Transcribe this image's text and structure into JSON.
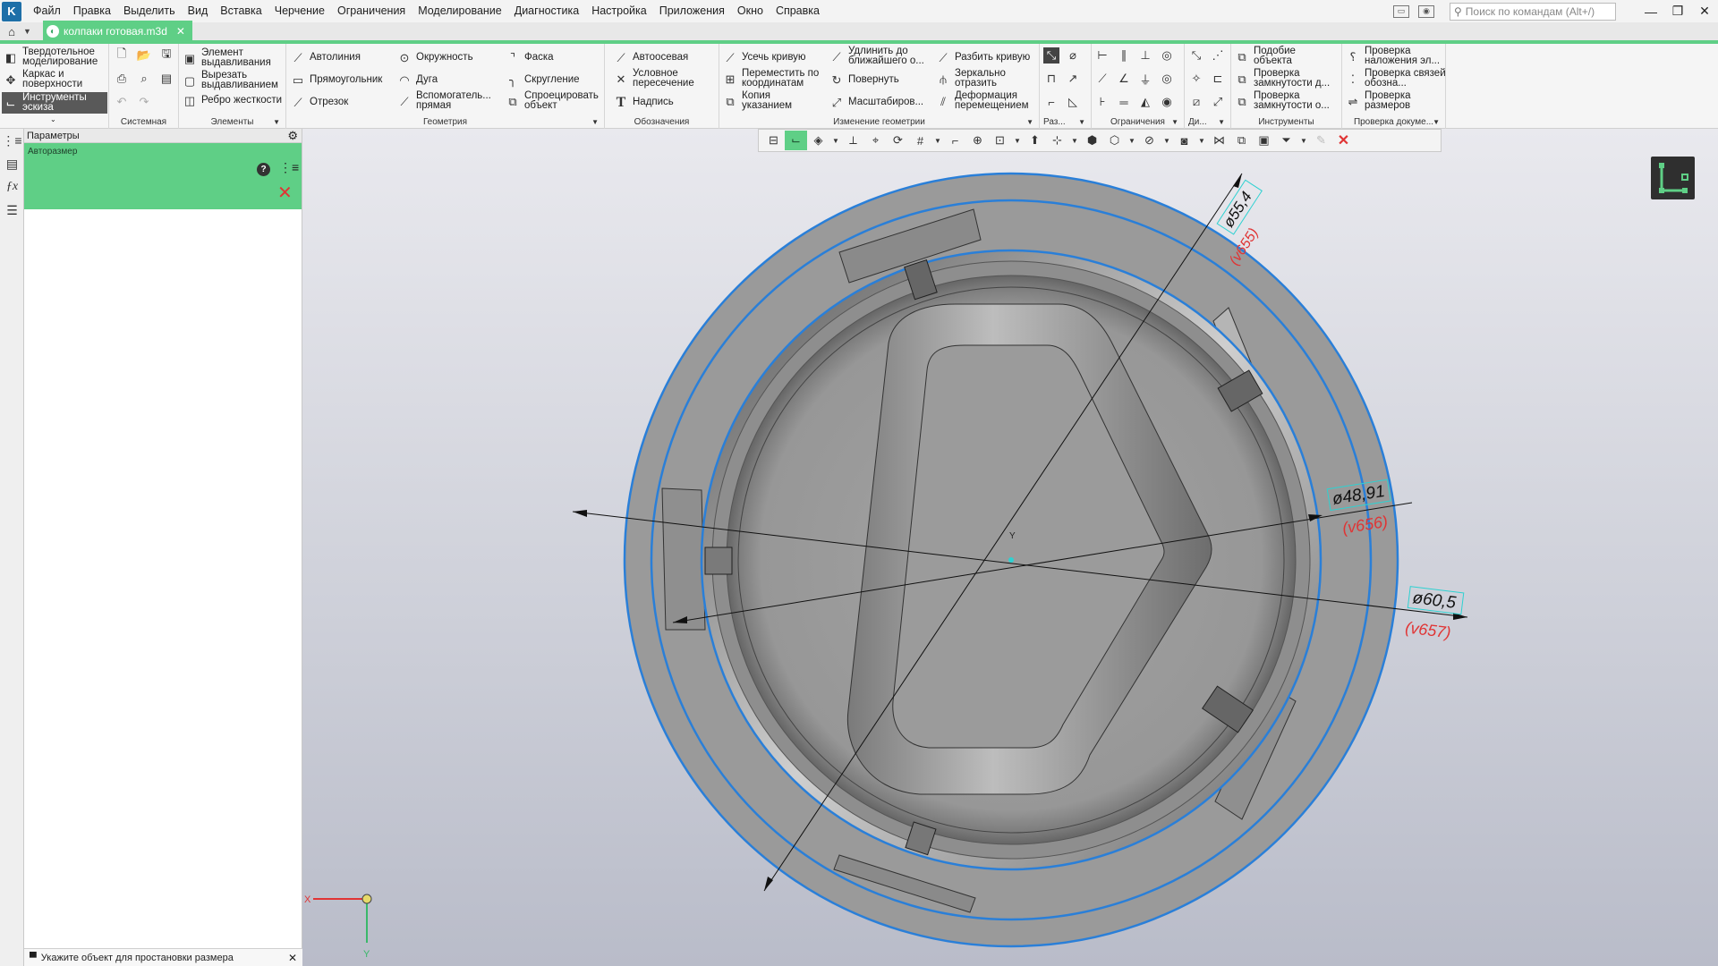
{
  "app": {
    "logo": "K"
  },
  "menu": [
    "Файл",
    "Правка",
    "Выделить",
    "Вид",
    "Вставка",
    "Черчение",
    "Ограничения",
    "Моделирование",
    "Диагностика",
    "Настройка",
    "Приложения",
    "Окно",
    "Справка"
  ],
  "search": {
    "placeholder": "Поиск по командам (Alt+/)"
  },
  "window": {
    "minimize": "—",
    "restore": "❐",
    "close": "✕"
  },
  "document_tab": {
    "name": "колпаки готовая.m3d",
    "close": "✕"
  },
  "ribbon": {
    "modes": [
      "Твердотельное моделирование",
      "Каркас и поверхности",
      "Инструменты эскиза"
    ],
    "groups": {
      "system": "Системная",
      "elements": "Элементы",
      "geometry": "Геометрия",
      "annotations": "Обозначения",
      "edit_geometry": "Изменение геометрии",
      "dims_short": "Раз...",
      "constraints": "Ограничения",
      "diag_short": "Ди...",
      "tools": "Инструменты",
      "doc_check": "Проверка докуме..."
    },
    "elements_buttons": [
      "Элемент выдавливания",
      "Вырезать выдавливанием",
      "Ребро жесткости"
    ],
    "geometry_buttons": [
      "Автолиния",
      "Прямоугольник",
      "Отрезок",
      "Окружность",
      "Дуга",
      "Вспомогатель... прямая",
      "Фаска",
      "Скругление",
      "Спроецировать объект"
    ],
    "annotation_buttons": [
      "Автоосевая",
      "Условное пересечение",
      "Надпись"
    ],
    "edit_buttons": [
      "Усечь кривую",
      "Переместить по координатам",
      "Копия указанием",
      "Удлинить до ближайшего о...",
      "Повернуть",
      "Масштабиров...",
      "Разбить кривую",
      "Зеркально отразить",
      "Деформация перемещением"
    ],
    "tools_buttons": [
      "Подобие объекта",
      "Проверка замкнутости д...",
      "Проверка замкнутости о..."
    ],
    "check_buttons": [
      "Проверка наложения эл...",
      "Проверка связей обозна...",
      "Проверка размеров"
    ]
  },
  "params_panel": {
    "header": "Параметры",
    "command": "Авторазмер",
    "help": "?",
    "cancel": "✕"
  },
  "status": {
    "text": "Укажите объект для простановки размера",
    "close": "✕"
  },
  "viewport": {
    "dimensions": [
      {
        "value": "ø55,4",
        "var": "(v655)"
      },
      {
        "value": "ø48,91",
        "var": "(v656)"
      },
      {
        "value": "ø60,5",
        "var": "(v657)"
      }
    ],
    "axis": {
      "x": "X",
      "y": "Y",
      "origin_y": "Y"
    }
  },
  "colors": {
    "accent": "#5fcf86",
    "dimension_text": "#e03434",
    "sketch_blue": "#2a7fd8"
  }
}
